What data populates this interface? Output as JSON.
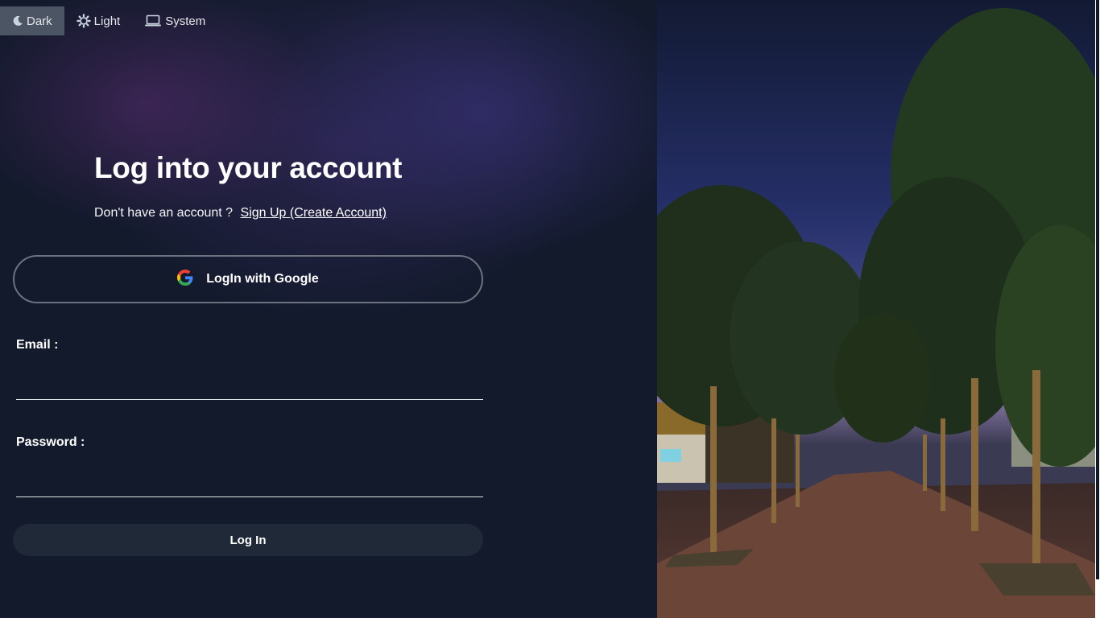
{
  "theme_switcher": {
    "options": [
      {
        "label": "Dark",
        "icon": "moon-icon",
        "active": true
      },
      {
        "label": "Light",
        "icon": "sun-icon",
        "active": false
      },
      {
        "label": "System",
        "icon": "laptop-icon",
        "active": false
      }
    ]
  },
  "login": {
    "title": "Log into your account",
    "signup_prompt": "Don't have an account ?",
    "signup_link": "Sign Up (Create Account)",
    "google_button": "LogIn with Google",
    "email_label": "Email :",
    "email_value": "",
    "password_label": "Password :",
    "password_value": "",
    "submit_button": "Log In"
  },
  "colors": {
    "background": "#111827",
    "button_bg": "#1f2937",
    "active_toggle": "#4b5563",
    "border": "#6b7280"
  },
  "image": {
    "description_icon": "campus-walkway-photo-icon"
  }
}
